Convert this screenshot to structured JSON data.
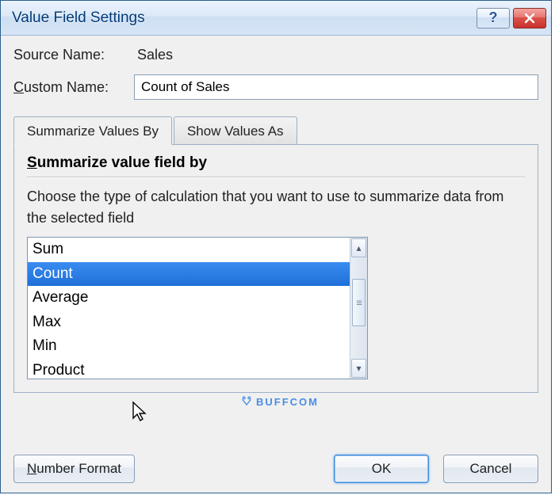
{
  "title": "Value Field Settings",
  "source": {
    "label": "Source Name:",
    "value": "Sales"
  },
  "custom": {
    "label": "Custom Name:",
    "value": "Count of Sales"
  },
  "tabs": {
    "active": "Summarize Values By",
    "other": "Show Values As"
  },
  "section": {
    "heading": "Summarize value field by",
    "description": "Choose the type of calculation that you want to use to summarize data from the selected field"
  },
  "list": {
    "items": [
      "Sum",
      "Count",
      "Average",
      "Max",
      "Min",
      "Product"
    ],
    "selected": "Count"
  },
  "buttons": {
    "numberFormat": "Number Format",
    "ok": "OK",
    "cancel": "Cancel"
  },
  "watermark": "BUFFCOM"
}
